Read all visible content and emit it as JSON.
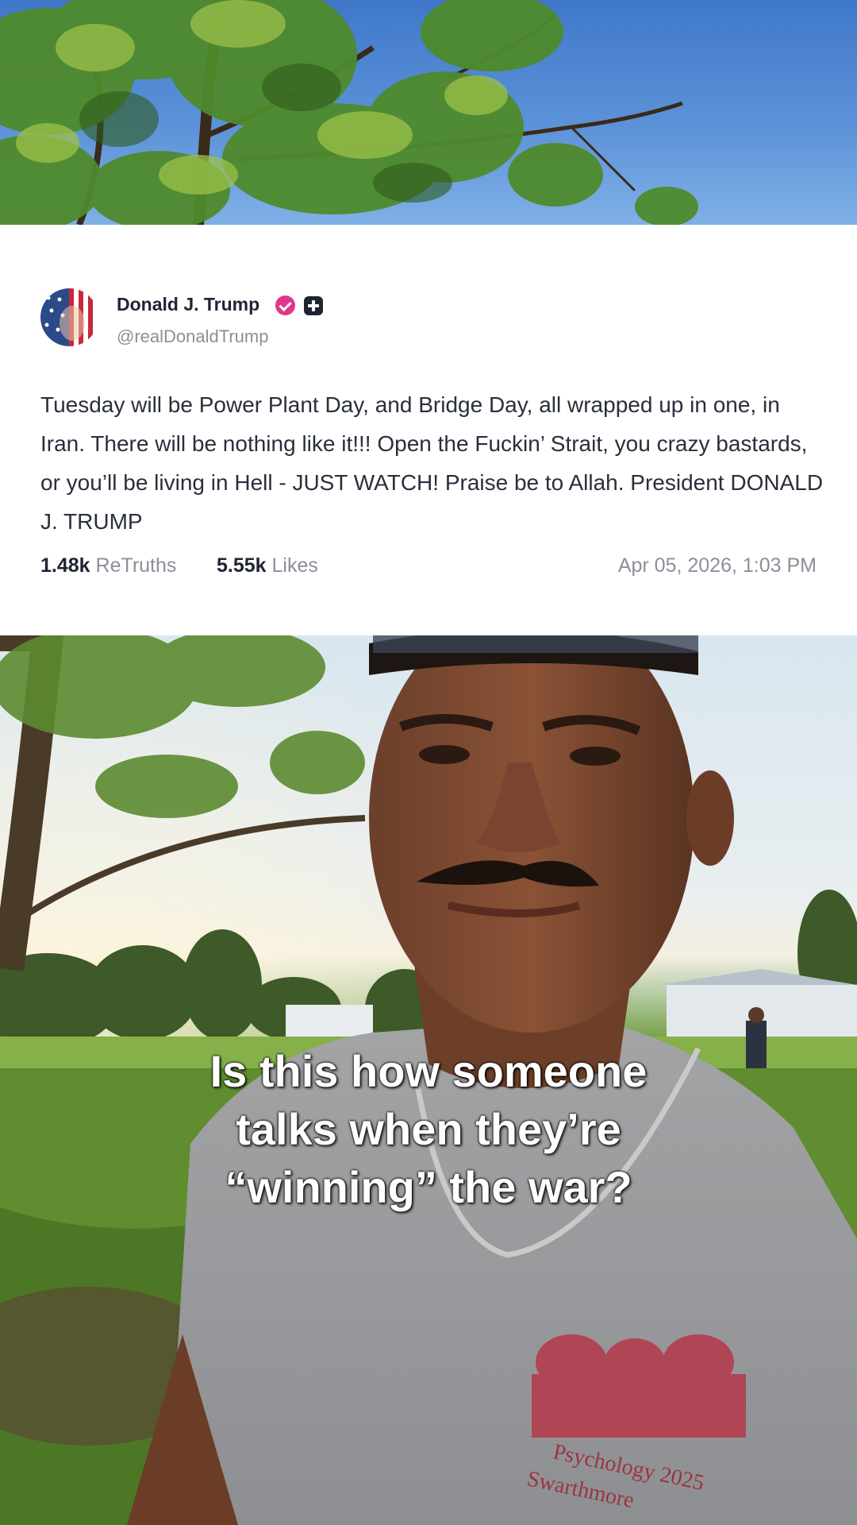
{
  "post": {
    "author_name": "Donald J. Trump",
    "author_handle": "@realDonaldTrump",
    "text": "Tuesday will be Power Plant Day, and Bridge Day, all wrapped up in one, in Iran. There will be nothing like it!!! Open the Fuckin’ Strait, you crazy bastards, or you’ll be living in Hell - JUST WATCH! Praise be to Allah. President DONALD J. TRUMP",
    "retruths_count": "1.48k",
    "retruths_label": "ReTruths",
    "likes_count": "5.55k",
    "likes_label": "Likes",
    "timestamp": "Apr 05, 2026, 1:03 PM"
  },
  "video": {
    "caption_lines": [
      "Is this how someone",
      "talks when they’re",
      "“winning” the war?"
    ],
    "shirt_text_line1": "Psychology 2025",
    "shirt_text_line2": "Swarthmore"
  },
  "icons": {
    "verified": "verified-badge-icon",
    "plus": "plus-icon",
    "avatar": "flag-avatar"
  },
  "colors": {
    "verified_badge": "#e0368a",
    "card_background": "#ffffff",
    "caption_text": "#ffffff"
  }
}
